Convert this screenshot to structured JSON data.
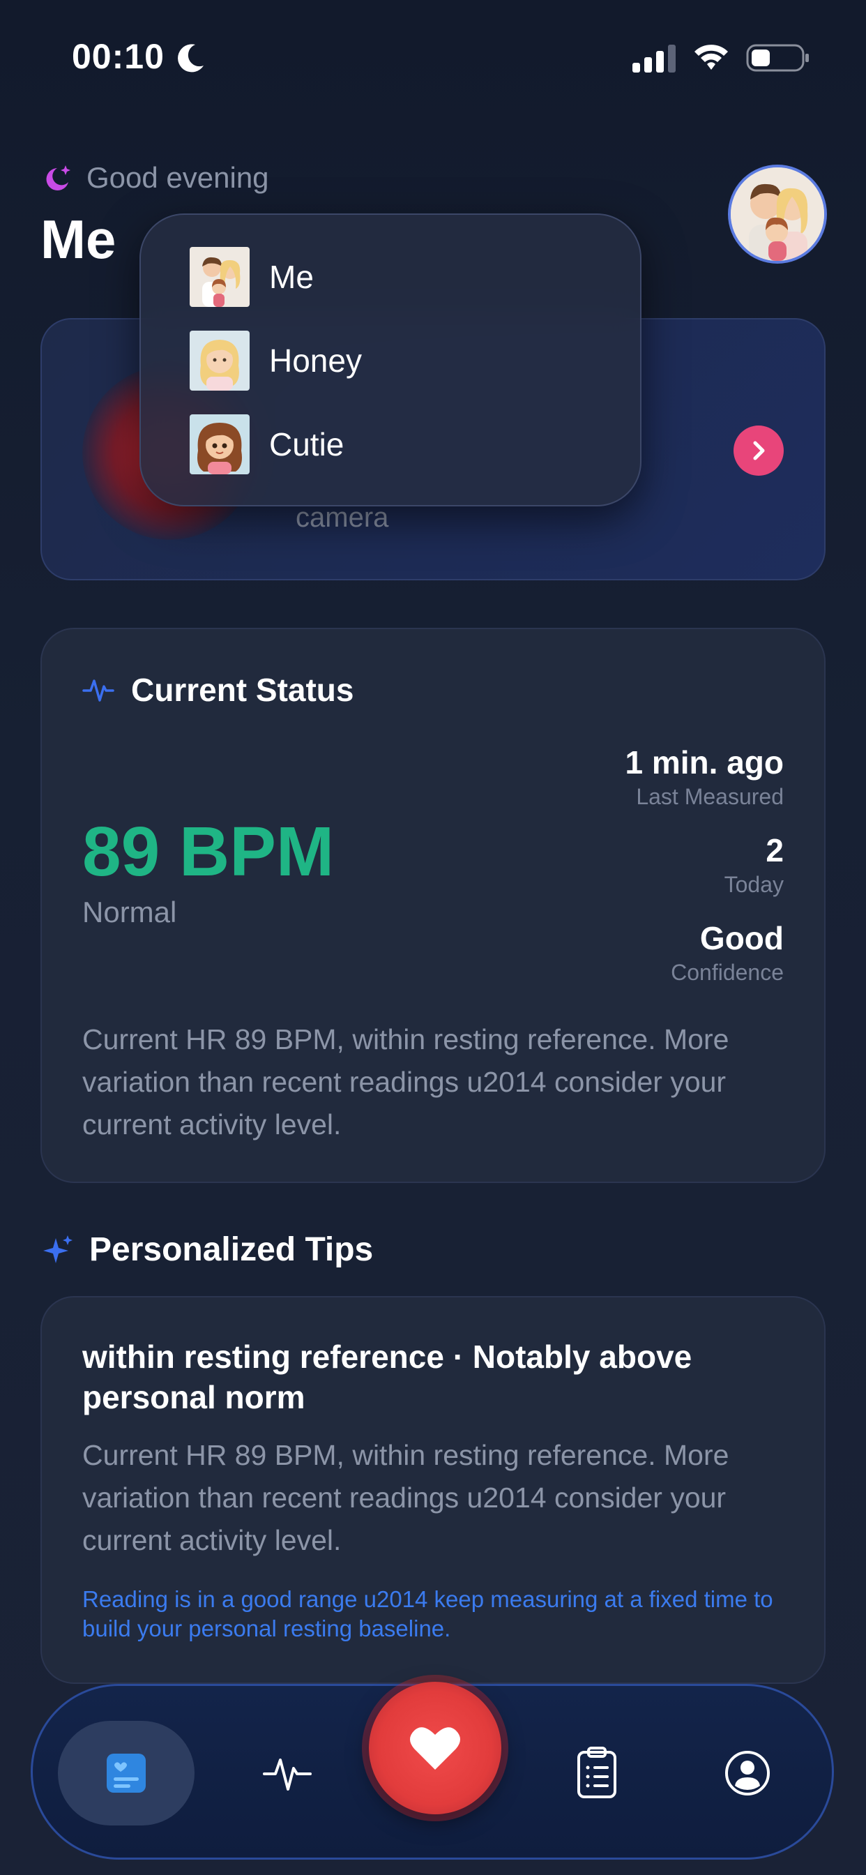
{
  "status_bar": {
    "time": "00:10",
    "icons": [
      "moon-icon",
      "signal-icon",
      "wifi-icon",
      "battery-icon"
    ]
  },
  "header": {
    "greeting": "Good evening",
    "profile_name": "Me",
    "avatar": "family-avatar"
  },
  "dropdown": {
    "items": [
      {
        "label": "Me",
        "thumb": "family-thumb"
      },
      {
        "label": "Honey",
        "thumb": "woman-thumb"
      },
      {
        "label": "Cutie",
        "thumb": "girl-thumb"
      }
    ]
  },
  "banner": {
    "subtitle": "camera",
    "arrow_icon": "chevron-right-icon"
  },
  "current_status": {
    "title": "Current Status",
    "bpm": "89 BPM",
    "state": "Normal",
    "metrics": [
      {
        "value": "1 min. ago",
        "label": "Last Measured"
      },
      {
        "value": "2",
        "label": "Today"
      },
      {
        "value": "Good",
        "label": "Confidence"
      }
    ],
    "description": "Current HR 89 BPM, within resting reference. More variation than recent readings u2014 consider your current activity level."
  },
  "tips": {
    "title": "Personalized Tips",
    "card": {
      "title": "within resting reference · Notably above personal norm",
      "body": "Current HR 89 BPM, within resting reference. More variation than recent readings u2014 consider your current activity level.",
      "note": "Reading is in a good range u2014 keep measuring at a fixed time to build your personal resting baseline."
    }
  },
  "colors": {
    "accent_green": "#1fb585",
    "accent_blue": "#3b7bef",
    "accent_red": "#e23c3c",
    "accent_pink": "#e8457a"
  },
  "tab_bar": {
    "tabs": [
      "home-tab",
      "pulse-tab",
      "measure-tab",
      "records-tab",
      "profile-tab"
    ]
  }
}
